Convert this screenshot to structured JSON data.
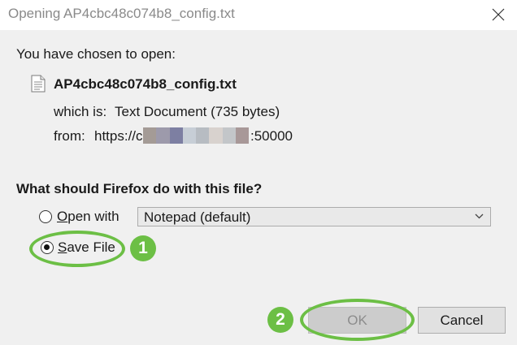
{
  "window": {
    "title": "Opening AP4cbc48c074b8_config.txt",
    "close_icon": "close-icon"
  },
  "dialog": {
    "intro": "You have chosen to open:",
    "file": {
      "icon": "text-document-icon",
      "name": "AP4cbc48c074b8_config.txt"
    },
    "which_label": "which is:",
    "which_value": "Text Document (735 bytes)",
    "from_label": "from:",
    "from_url_prefix": "https://c",
    "from_url_suffix": ":50000",
    "redaction_colors": [
      "#a49b96",
      "#9d9aab",
      "#7d7fa2",
      "#c7ced6",
      "#b7bcc2",
      "#d8d2ce",
      "#c3c6c9",
      "#a89898"
    ]
  },
  "question": "What should Firefox do with this file?",
  "options": {
    "open_with": {
      "label_mnemonic": "O",
      "label_rest": "pen with",
      "selected": false,
      "app": "Notepad (default)"
    },
    "save_file": {
      "label_mnemonic": "S",
      "label_rest": "ave File",
      "selected": true
    }
  },
  "buttons": {
    "ok": "OK",
    "cancel": "Cancel"
  },
  "annotations": {
    "badge_1": "1",
    "badge_2": "2",
    "highlight_color": "#6cbf45"
  }
}
